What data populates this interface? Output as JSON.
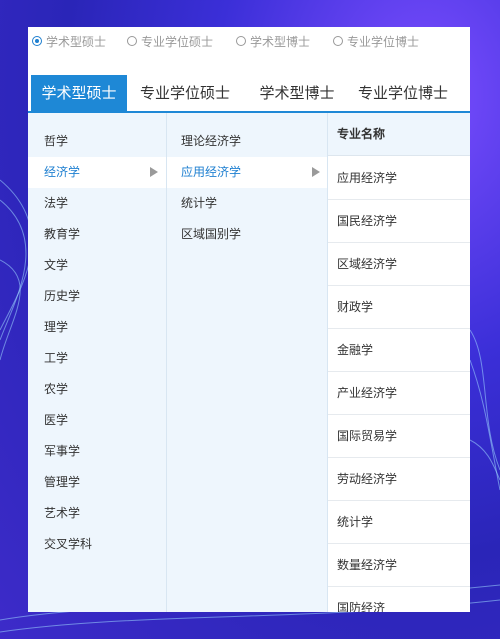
{
  "radios": [
    {
      "label": "学术型硕士",
      "checked": true
    },
    {
      "label": "专业学位硕士",
      "checked": false
    },
    {
      "label": "学术型博士",
      "checked": false
    },
    {
      "label": "专业学位博士",
      "checked": false
    }
  ],
  "tabs": [
    {
      "label": "学术型硕士",
      "active": true
    },
    {
      "label": "专业学位硕士",
      "active": false
    },
    {
      "label": "学术型博士",
      "active": false
    },
    {
      "label": "专业学位博士",
      "active": false
    }
  ],
  "disciplines": [
    "哲学",
    "经济学",
    "法学",
    "教育学",
    "文学",
    "历史学",
    "理学",
    "工学",
    "农学",
    "医学",
    "军事学",
    "管理学",
    "艺术学",
    "交叉学科"
  ],
  "selected_discipline": "经济学",
  "subcategories": [
    "理论经济学",
    "应用经济学",
    "统计学",
    "区域国别学"
  ],
  "selected_subcategory": "应用经济学",
  "majors_header": "专业名称",
  "majors": [
    "应用经济学",
    "国民经济学",
    "区域经济学",
    "财政学",
    "金融学",
    "产业经济学",
    "国际贸易学",
    "劳动经济学",
    "统计学",
    "数量经济学",
    "国防经济"
  ],
  "colors": {
    "accent": "#1e88d6",
    "panel_bg": "#eef6fd"
  }
}
